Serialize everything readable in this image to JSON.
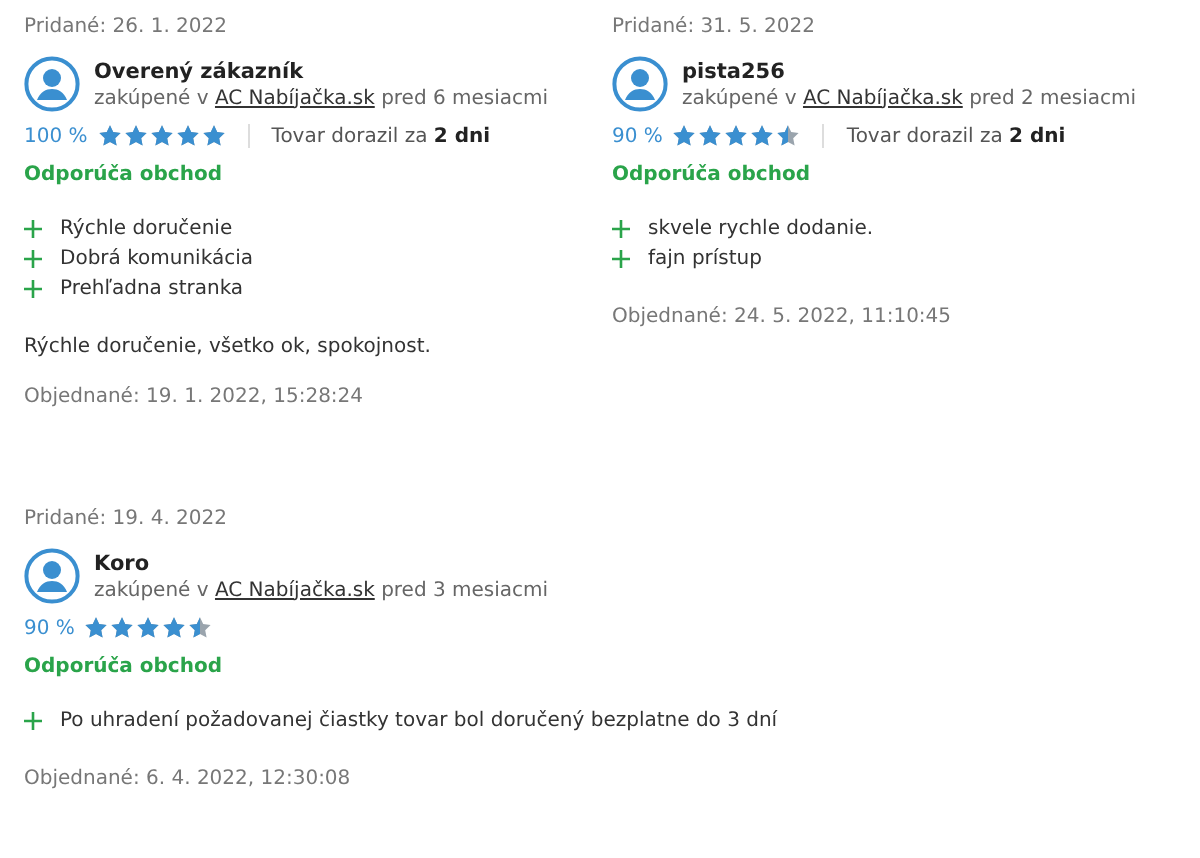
{
  "reviews": [
    {
      "added": "Pridané: 26. 1. 2022",
      "name": "Overený zákazník",
      "purchase_prefix": "zakúpené v",
      "shop": "AC Nabíjačka.sk",
      "purchase_suffix": "pred 6 mesiacmi",
      "percent": "100 %",
      "stars": 5,
      "delivery": "Tovar dorazil za **2 dni**",
      "recommends": "Odporúča obchod",
      "pros": [
        "Rýchle doručenie",
        "Dobrá komunikácia",
        "Prehľadna stranka"
      ],
      "comment": "Rýchle doručenie, všetko ok, spokojnost.",
      "ordered": "Objednané: 19. 1. 2022, 15:28:24"
    },
    {
      "added": "Pridané: 31. 5. 2022",
      "name": "pista256",
      "purchase_prefix": "zakúpené v",
      "shop": "AC Nabíjačka.sk",
      "purchase_suffix": "pred 2 mesiacmi",
      "percent": "90 %",
      "stars": 4.5,
      "delivery": "Tovar dorazil za **2 dni**",
      "recommends": "Odporúča obchod",
      "pros": [
        "skvele rychle dodanie.",
        "fajn prístup"
      ],
      "ordered": "Objednané: 24. 5. 2022, 11:10:45"
    },
    {
      "added": "Pridané: 19. 4. 2022",
      "name": "Koro",
      "purchase_prefix": "zakúpené v",
      "shop": "AC Nabíjačka.sk",
      "purchase_suffix": "pred 3 mesiacmi",
      "percent": "90 %",
      "stars": 4.5,
      "recommends": "Odporúča obchod",
      "pros": [
        "Po uhradení požadovanej čiastky tovar bol doručený bezplatne do 3 dní"
      ],
      "ordered": "Objednané: 6. 4. 2022, 12:30:08"
    }
  ]
}
